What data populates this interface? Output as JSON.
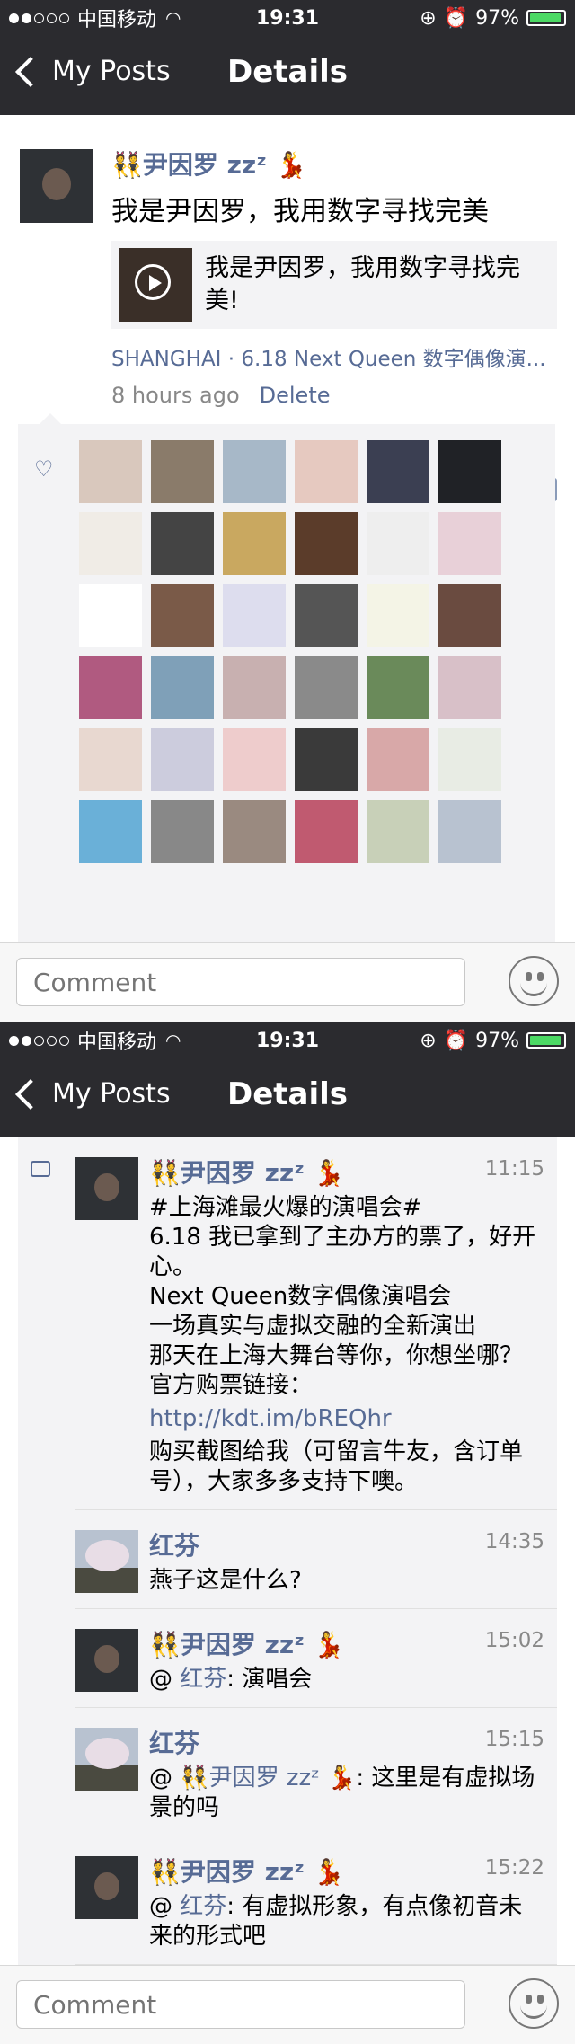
{
  "status": {
    "carrier": "中国移动",
    "time": "19:31",
    "battery": "97%"
  },
  "nav": {
    "back": "My Posts",
    "title": "Details"
  },
  "post": {
    "username": "👯尹因罗 zzᶻ 💃",
    "text": "我是尹因罗，我用数字寻找完美",
    "link_title": "我是尹因罗，我用数字寻找完美!",
    "location": "SHANGHAI · 6.18 Next Queen 数字偶像演...",
    "time_ago": "8 hours ago",
    "delete": "Delete"
  },
  "likes": {
    "avatar_count": 36
  },
  "comment_bar": {
    "placeholder": "Comment"
  },
  "detail": {
    "username": "👯尹因罗 zzᶻ 💃",
    "time": "11:15",
    "lines": "#上海滩最火爆的演唱会#\n6.18 我已拿到了主办方的票了，好开心。\nNext Queen数字偶像演唱会\n一场真实与虚拟交融的全新演出\n那天在上海大舞台等你，你想坐哪？\n官方购票链接：",
    "link": "http://kdt.im/bREQhr",
    "tail": "购买截图给我（可留言牛友，含订单号），大家多多支持下噢。"
  },
  "comments": [
    {
      "name": "红芬",
      "time": "14:35",
      "prefix": "",
      "mention": "",
      "text": "燕子这是什么?"
    },
    {
      "name": "👯尹因罗 zzᶻ 💃",
      "time": "15:02",
      "prefix": "@ ",
      "mention": "红芬",
      "text": ": 演唱会"
    },
    {
      "name": "红芬",
      "time": "15:15",
      "prefix": "@ ",
      "mention": "👯尹因罗 zzᶻ 💃",
      "text": ": 这里是有虚拟场景的吗"
    },
    {
      "name": "👯尹因罗 zzᶻ 💃",
      "time": "15:22",
      "prefix": "@ ",
      "mention": "红芬",
      "text": ": 有虚拟形象，有点像初音未来的形式吧"
    }
  ]
}
